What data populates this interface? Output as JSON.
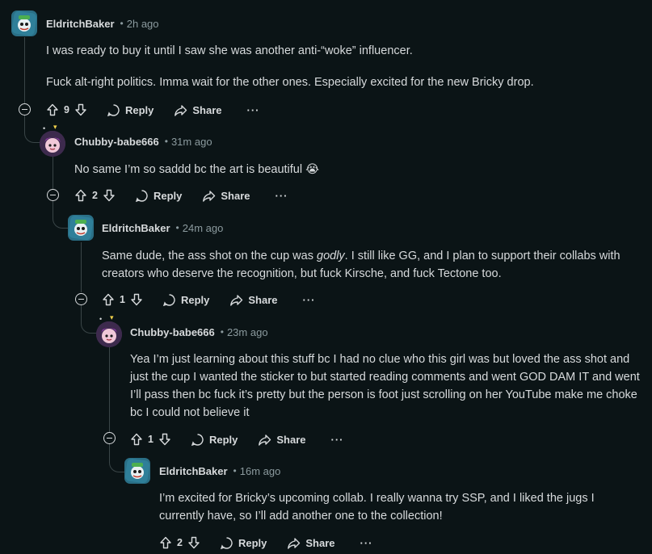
{
  "comments": [
    {
      "author": "EldritchBaker",
      "time": "2h ago",
      "paragraphs": [
        "I was ready to buy it until I saw she was another anti-“woke” influencer.",
        "Fuck alt-right politics. Imma wait for the other ones. Especially excited for the new Bricky drop."
      ],
      "votes": "9",
      "reply_label": "Reply",
      "share_label": "Share",
      "more_label": "···"
    },
    {
      "author": "Chubby-babe666",
      "time": "31m ago",
      "text": "No same I’m so saddd bc the art is beautiful",
      "emoji": "😭",
      "votes": "2",
      "reply_label": "Reply",
      "share_label": "Share",
      "more_label": "···"
    },
    {
      "author": "EldritchBaker",
      "time": "24m ago",
      "text_before": "Same dude, the ass shot on the cup was ",
      "text_em": "godly",
      "text_after": ". I still like GG, and I plan to support their collabs with creators who deserve the recognition, but fuck Kirsche, and fuck Tectone too.",
      "votes": "1",
      "reply_label": "Reply",
      "share_label": "Share",
      "more_label": "···"
    },
    {
      "author": "Chubby-babe666",
      "time": "23m ago",
      "text": "Yea I’m just learning about this stuff bc I had no clue who this girl was but loved the ass shot and just the cup I wanted the sticker to but started reading comments and went GOD DAM IT and went I’ll pass then bc fuck it’s pretty but the person is foot just scrolling on her YouTube make me choke bc I could not believe it",
      "votes": "1",
      "reply_label": "Reply",
      "share_label": "Share",
      "more_label": "···"
    },
    {
      "author": "EldritchBaker",
      "time": "16m ago",
      "text": "I’m excited for Bricky’s upcoming collab. I really wanna try SSP, and I liked the jugs I currently have, so I’ll add another one to the collection!",
      "votes": "2",
      "reply_label": "Reply",
      "share_label": "Share",
      "more_label": "···"
    }
  ],
  "separator": "•",
  "colors": {
    "background": "#0b1416",
    "text": "#d7dadc",
    "muted": "#8b9a9e",
    "thread_line": "#3a4547"
  }
}
